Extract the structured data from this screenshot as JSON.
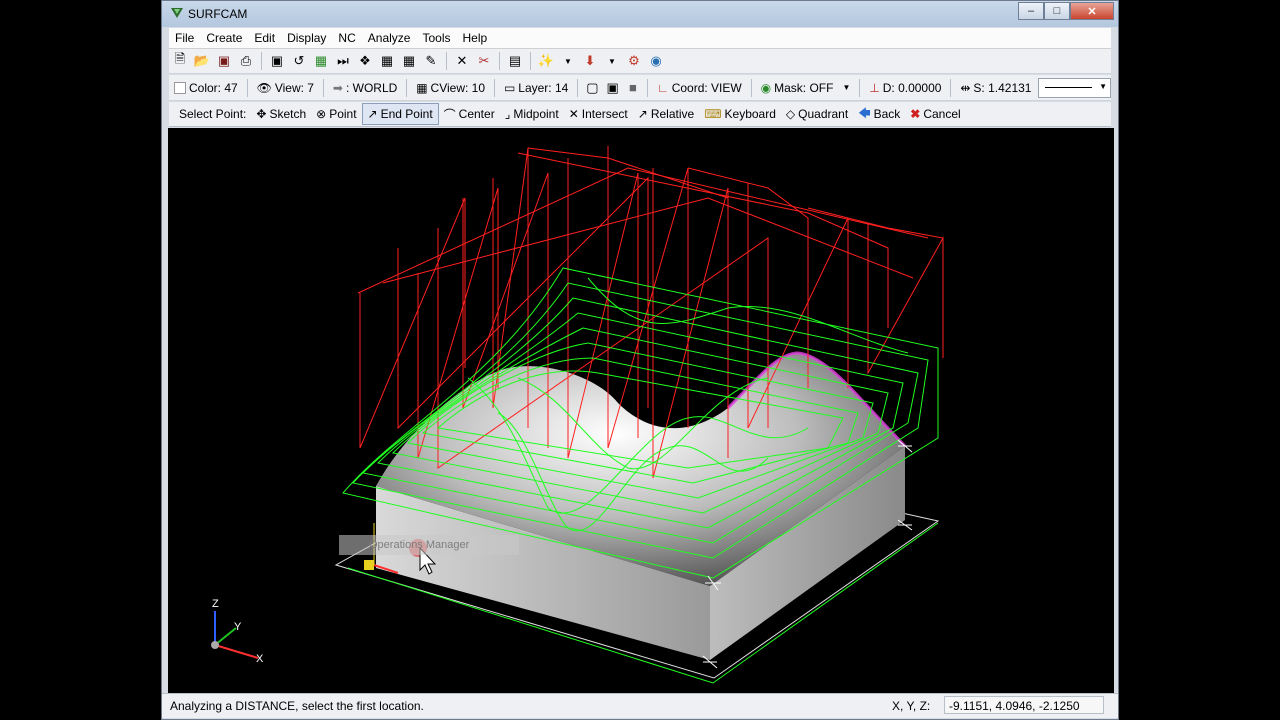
{
  "window": {
    "title": "SURFCAM"
  },
  "menu": [
    "File",
    "Create",
    "Edit",
    "Display",
    "NC",
    "Analyze",
    "Tools",
    "Help"
  ],
  "toolbar2": {
    "color": "Color: 47",
    "view": "View: 7",
    "world": ": WORLD",
    "cview": "CView: 10",
    "layer": "Layer: 14",
    "coord": "Coord: VIEW",
    "mask": "Mask: OFF",
    "depth": "D: 0.00000",
    "step": "S: 1.42131"
  },
  "toolbar3": {
    "select_point": "Select Point:",
    "sketch": "Sketch",
    "point": "Point",
    "end_point": "End Point",
    "center": "Center",
    "midpoint": "Midpoint",
    "intersect": "Intersect",
    "relative": "Relative",
    "keyboard": "Keyboard",
    "quadrant": "Quadrant",
    "back": "Back",
    "cancel": "Cancel"
  },
  "viewport": {
    "tooltip": "Operations Manager",
    "axes": {
      "x": "X",
      "y": "Y",
      "z": "Z"
    }
  },
  "status": {
    "message": "Analyzing a DISTANCE, select the first location.",
    "xyz_label": "X, Y, Z:",
    "coords": "-9.1151, 4.0946, -2.1250"
  },
  "colors": {
    "toolpath_rapid": "#ff2020",
    "toolpath_feed": "#20ff20",
    "surface_highlight": "#e040e0"
  }
}
